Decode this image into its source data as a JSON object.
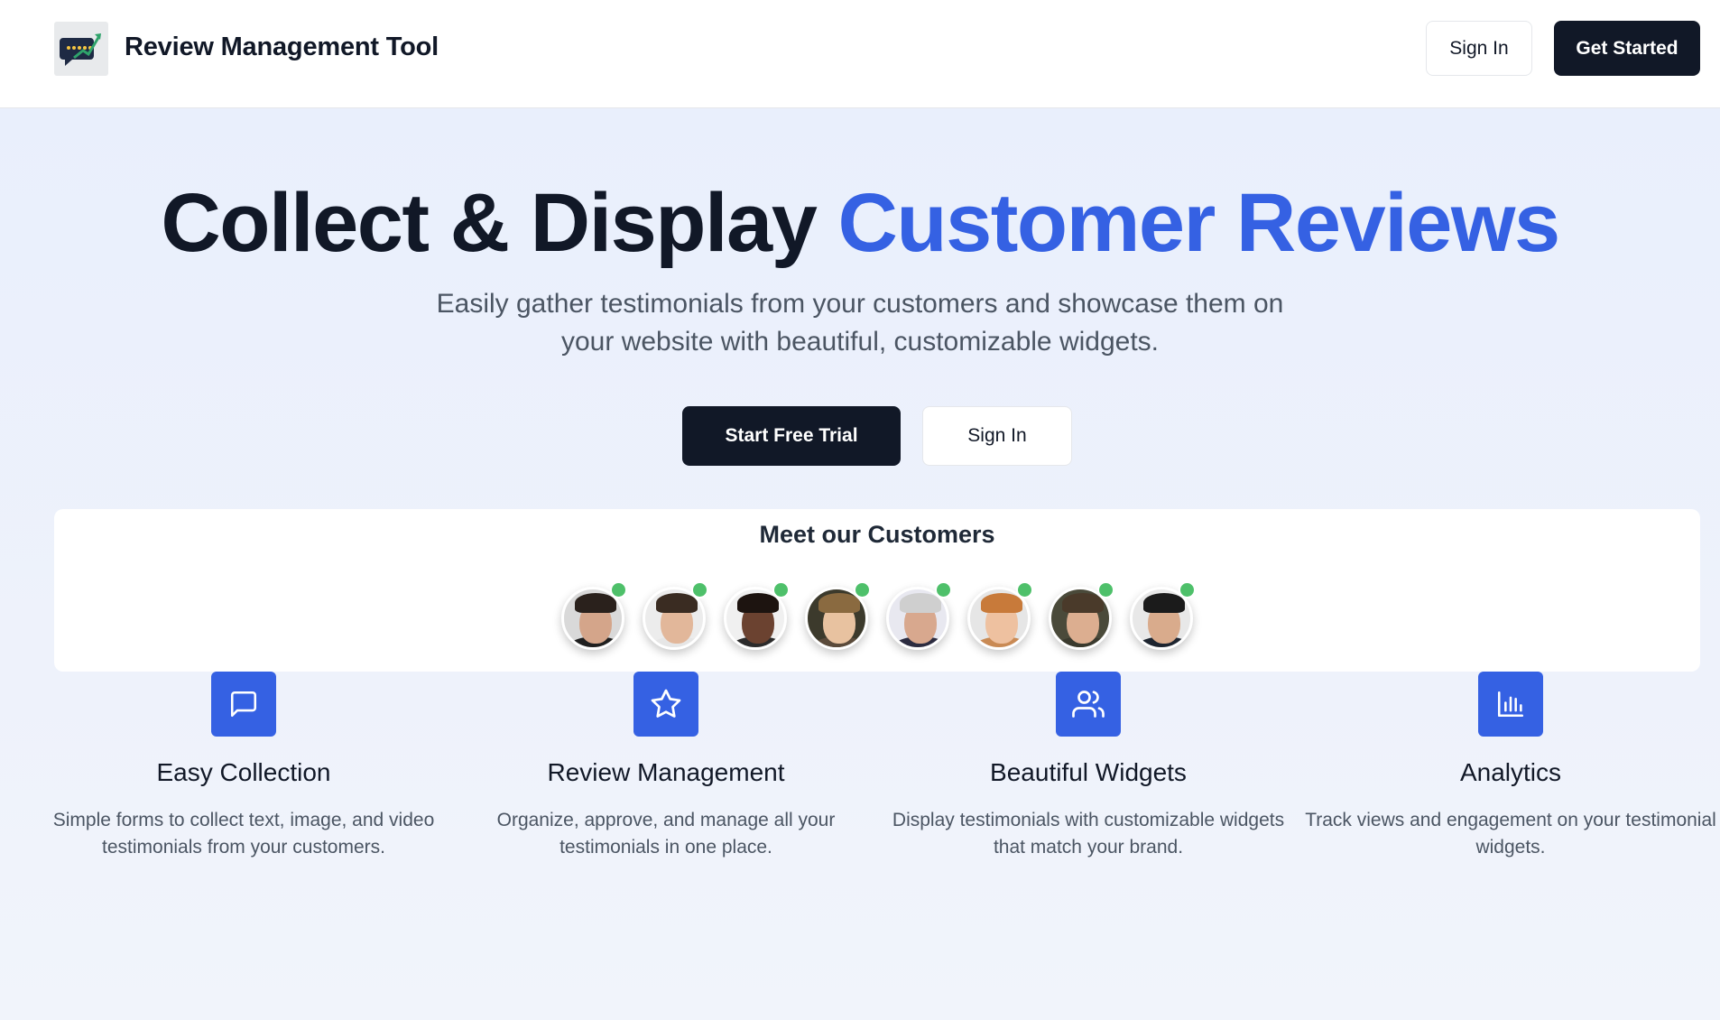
{
  "header": {
    "brand": "Review Management Tool",
    "sign_in_label": "Sign In",
    "get_started_label": "Get Started"
  },
  "hero": {
    "title_main": "Collect & Display ",
    "title_accent": "Customer Reviews",
    "subtitle": "Easily gather testimonials from your customers and showcase them on your website with beautiful, customizable widgets.",
    "trial_label": "Start Free Trial",
    "sign_in_label": "Sign In"
  },
  "customers": {
    "title": "Meet our Customers",
    "avatars": [
      {
        "name": "customer-avatar-1",
        "online": true
      },
      {
        "name": "customer-avatar-2",
        "online": true
      },
      {
        "name": "customer-avatar-3",
        "online": true
      },
      {
        "name": "customer-avatar-4",
        "online": true
      },
      {
        "name": "customer-avatar-5",
        "online": true
      },
      {
        "name": "customer-avatar-6",
        "online": true
      },
      {
        "name": "customer-avatar-7",
        "online": true
      },
      {
        "name": "customer-avatar-8",
        "online": true
      }
    ]
  },
  "features": [
    {
      "icon": "message-square-icon",
      "title": "Easy Collection",
      "description": "Simple forms to collect text, image, and video testimonials from your customers."
    },
    {
      "icon": "star-icon",
      "title": "Review Management",
      "description": "Organize, approve, and manage all your testimonials in one place."
    },
    {
      "icon": "users-icon",
      "title": "Beautiful Widgets",
      "description": "Display testimonials with customizable widgets that match your brand."
    },
    {
      "icon": "bar-chart-icon",
      "title": "Analytics",
      "description": "Track views and engagement on your testimonial widgets."
    }
  ],
  "colors": {
    "primary_dark": "#111827",
    "accent_blue": "#3561e3",
    "online_green": "#4ec06a",
    "hero_bg": "#e9effc"
  }
}
